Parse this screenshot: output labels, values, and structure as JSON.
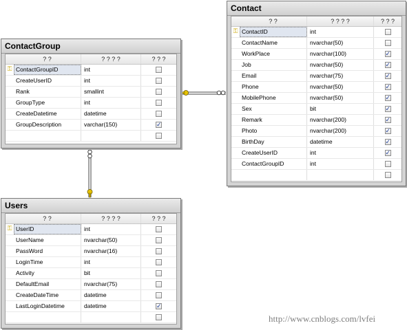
{
  "watermark": "http://www.cnblogs.com/lvfei",
  "columns_header": {
    "name": "? ?",
    "type": "? ? ? ?",
    "nullable": "? ? ?"
  },
  "tables": {
    "contactgroup": {
      "title": "ContactGroup",
      "rows": [
        {
          "name": "ContactGroupID",
          "type": "int",
          "nullable": false,
          "key": true
        },
        {
          "name": "CreateUserID",
          "type": "int",
          "nullable": false,
          "key": false
        },
        {
          "name": "Rank",
          "type": "smallint",
          "nullable": false,
          "key": false
        },
        {
          "name": "GroupType",
          "type": "int",
          "nullable": false,
          "key": false
        },
        {
          "name": "CreateDatetime",
          "type": "datetime",
          "nullable": false,
          "key": false
        },
        {
          "name": "GroupDescription",
          "type": "varchar(150)",
          "nullable": true,
          "key": false
        },
        {
          "name": "",
          "type": "",
          "nullable": false,
          "key": false
        }
      ]
    },
    "contact": {
      "title": "Contact",
      "rows": [
        {
          "name": "ContactID",
          "type": "int",
          "nullable": false,
          "key": true
        },
        {
          "name": "ContactName",
          "type": "nvarchar(50)",
          "nullable": false,
          "key": false
        },
        {
          "name": "WorkPlace",
          "type": "nvarchar(100)",
          "nullable": true,
          "key": false
        },
        {
          "name": "Job",
          "type": "nvarchar(50)",
          "nullable": true,
          "key": false
        },
        {
          "name": "Email",
          "type": "nvarchar(75)",
          "nullable": true,
          "key": false
        },
        {
          "name": "Phone",
          "type": "nvarchar(50)",
          "nullable": true,
          "key": false
        },
        {
          "name": "MobilePhone",
          "type": "nvarchar(50)",
          "nullable": true,
          "key": false
        },
        {
          "name": "Sex",
          "type": "bit",
          "nullable": true,
          "key": false
        },
        {
          "name": "Remark",
          "type": "nvarchar(200)",
          "nullable": true,
          "key": false
        },
        {
          "name": "Photo",
          "type": "nvarchar(200)",
          "nullable": true,
          "key": false
        },
        {
          "name": "BirthDay",
          "type": "datetime",
          "nullable": true,
          "key": false
        },
        {
          "name": "CreateUserID",
          "type": "int",
          "nullable": true,
          "key": false
        },
        {
          "name": "ContactGroupID",
          "type": "int",
          "nullable": false,
          "key": false
        },
        {
          "name": "",
          "type": "",
          "nullable": false,
          "key": false
        }
      ]
    },
    "users": {
      "title": "Users",
      "rows": [
        {
          "name": "UserID",
          "type": "int",
          "nullable": false,
          "key": true
        },
        {
          "name": "UserName",
          "type": "nvarchar(50)",
          "nullable": false,
          "key": false
        },
        {
          "name": "PassWord",
          "type": "nvarchar(16)",
          "nullable": false,
          "key": false
        },
        {
          "name": "LoginTime",
          "type": "int",
          "nullable": false,
          "key": false
        },
        {
          "name": "Activity",
          "type": "bit",
          "nullable": false,
          "key": false
        },
        {
          "name": "DefaultEmail",
          "type": "nvarchar(75)",
          "nullable": false,
          "key": false
        },
        {
          "name": "CreateDateTime",
          "type": "datetime",
          "nullable": false,
          "key": false
        },
        {
          "name": "LastLoginDatetime",
          "type": "datetime",
          "nullable": true,
          "key": false
        },
        {
          "name": "",
          "type": "",
          "nullable": false,
          "key": false
        }
      ]
    }
  }
}
